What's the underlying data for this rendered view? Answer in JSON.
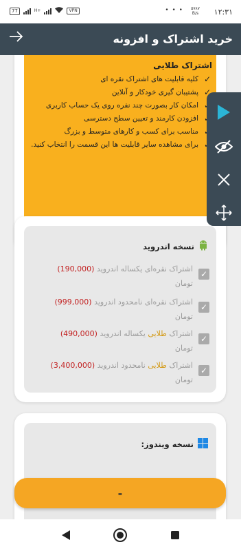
{
  "status_bar": {
    "time": "۱۲:۳۱",
    "net_speed_value": "۵۷۸۷",
    "net_speed_unit": "B/s",
    "battery": "77",
    "signal_label": "H+",
    "vpn": "VPN",
    "dots": "• • •"
  },
  "header": {
    "title": "خرید اشتراک و افزونه",
    "back_icon": "arrow-right-icon"
  },
  "gold_plan": {
    "title": "اشتراک طلایی",
    "features": [
      "کلیه قابلیت های اشتراک نقره ای",
      "پشتیبان گیری خودکار و آنلاین",
      "امکان کار بصورت چند نفره روی یک حساب کاربری",
      "افزودن کارمند و تعیین سطح دسترسی",
      "مناسب برای کسب و کارهای متوسط و بزرگ",
      "برای مشاهده سایر قابلیت ها این قسمت را انتخاب کنید."
    ],
    "bg_color": "#f9b01e"
  },
  "android": {
    "title": "نسخه اندروید",
    "icon": "android-icon",
    "options": [
      {
        "pre": "اشتراک نقره‌ای یکساله اندروید",
        "gold_word": "",
        "post": "",
        "price": "(190,000)",
        "currency": "تومان",
        "checked": true
      },
      {
        "pre": "اشتراک نقره‌ای نامحدود اندروید",
        "gold_word": "",
        "post": "",
        "price": "(999,000)",
        "currency": "تومان",
        "checked": true
      },
      {
        "pre": "اشتراک",
        "gold_word": "طلایی",
        "post": "یکساله اندروید",
        "price": "(490,000)",
        "currency": "تومان",
        "checked": true
      },
      {
        "pre": "اشتراک",
        "gold_word": "طلایی",
        "post": "نامحدود اندروید",
        "price": "(3,400,000)",
        "currency": "تومان",
        "checked": true
      }
    ]
  },
  "windows": {
    "title": "نسخه ویندوز:",
    "icon": "windows-icon"
  },
  "side_toolbar": {
    "tools": [
      "play-icon",
      "eye-off-icon",
      "close-icon",
      "move-icon"
    ],
    "accent": "#2bb5d6"
  },
  "bottom_button": {
    "label": "-",
    "color": "#f5a623"
  },
  "nav_bar": {
    "buttons": [
      "back-triangle-icon",
      "home-circle-icon",
      "recents-square-icon"
    ]
  }
}
